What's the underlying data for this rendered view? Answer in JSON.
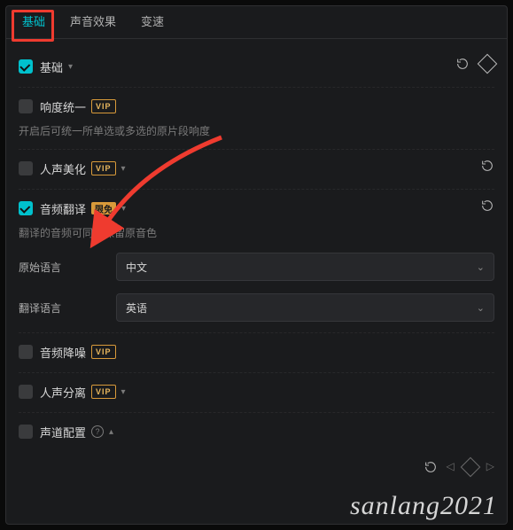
{
  "tabs": {
    "basic": "基础",
    "soundfx": "声音效果",
    "speed": "变速"
  },
  "sections": {
    "basic": {
      "label": "基础"
    },
    "loudness": {
      "label": "响度统一",
      "badge": "VIP",
      "desc": "开启后可统一所单选或多选的原片段响度"
    },
    "beautify": {
      "label": "人声美化",
      "badge": "VIP"
    },
    "translate": {
      "label": "音频翻译",
      "badge": "限免",
      "desc": "翻译的音频可同时保留原音色",
      "src_label": "原始语言",
      "src_value": "中文",
      "dst_label": "翻译语言",
      "dst_value": "英语"
    },
    "denoise": {
      "label": "音频降噪",
      "badge": "VIP"
    },
    "separate": {
      "label": "人声分离",
      "badge": "VIP"
    },
    "channel": {
      "label": "声道配置"
    }
  },
  "watermark": "sanlang2021"
}
